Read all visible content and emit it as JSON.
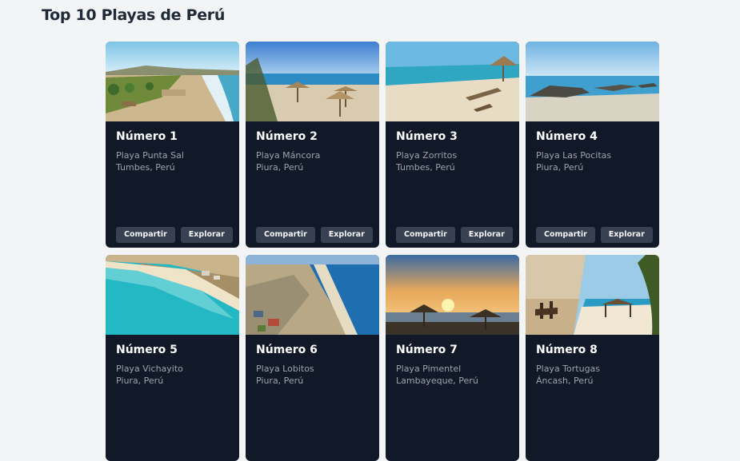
{
  "page": {
    "title": "Top 10 Playas de Perú"
  },
  "cards": [
    {
      "title": "Número 1",
      "beach": "Playa Punta Sal",
      "location": "Tumbes, Perú",
      "share_label": "Compartir",
      "explore_label": "Explorar"
    },
    {
      "title": "Número 2",
      "beach": "Playa Máncora",
      "location": "Piura, Perú",
      "share_label": "Compartir",
      "explore_label": "Explorar"
    },
    {
      "title": "Número 3",
      "beach": "Playa Zorritos",
      "location": "Tumbes, Perú",
      "share_label": "Compartir",
      "explore_label": "Explorar"
    },
    {
      "title": "Número 4",
      "beach": "Playa Las Pocitas",
      "location": "Piura, Perú",
      "share_label": "Compartir",
      "explore_label": "Explorar"
    },
    {
      "title": "Número 5",
      "beach": "Playa Vichayito",
      "location": "Piura, Perú"
    },
    {
      "title": "Número 6",
      "beach": "Playa Lobitos",
      "location": "Piura, Perú"
    },
    {
      "title": "Número 7",
      "beach": "Playa Pimentel",
      "location": "Lambayeque, Perú"
    },
    {
      "title": "Número 8",
      "beach": "Playa Tortugas",
      "location": "Áncash, Perú"
    }
  ],
  "colors": {
    "card_bg": "#111827",
    "button_bg": "#374151",
    "page_bg": "#f3f4f6",
    "title_text": "#1f2937"
  }
}
